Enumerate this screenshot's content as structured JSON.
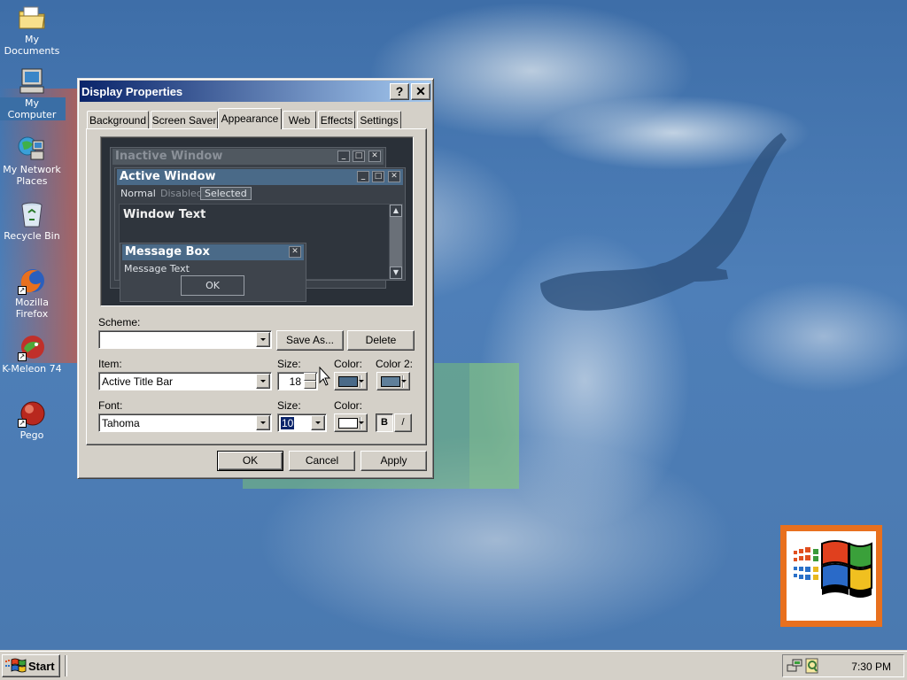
{
  "desktop": {
    "icons": [
      {
        "label": "My Documents",
        "icon": "folder-documents-icon"
      },
      {
        "label": "My Computer",
        "icon": "computer-icon"
      },
      {
        "label": "My Network Places",
        "icon": "network-places-icon"
      },
      {
        "label": "Recycle Bin",
        "icon": "recycle-bin-icon"
      },
      {
        "label": "Mozilla Firefox",
        "icon": "firefox-icon"
      },
      {
        "label": "K-Meleon 74",
        "icon": "k-meleon-icon"
      },
      {
        "label": "Pego",
        "icon": "pego-icon"
      }
    ],
    "background_color": "#4a79b0"
  },
  "dialog": {
    "title": "Display Properties",
    "help_glyph": "?",
    "close_glyph": "✕",
    "tabs": [
      "Background",
      "Screen Saver",
      "Appearance",
      "Web",
      "Effects",
      "Settings"
    ],
    "active_tab": "Appearance",
    "preview": {
      "inactive_title": "Inactive Window",
      "active_title": "Active Window",
      "menu": {
        "normal": "Normal",
        "disabled": "Disabled",
        "selected": "Selected"
      },
      "window_text": "Window Text",
      "message_box_title": "Message Box",
      "message_text": "Message Text",
      "ok": "OK"
    },
    "scheme": {
      "label": "Scheme:",
      "value": "",
      "save_as": "Save As...",
      "delete": "Delete"
    },
    "item": {
      "label": "Item:",
      "value": "Active Title Bar",
      "size_label": "Size:",
      "size_value": "18",
      "color_label": "Color:",
      "color2_label": "Color 2:",
      "color_value": "#4a6a88",
      "color2_value": "#5f7f9a"
    },
    "font": {
      "label": "Font:",
      "value": "Tahoma",
      "size_label": "Size:",
      "size_value": "10",
      "color_label": "Color:",
      "color_value": "#ffffff",
      "bold": "B",
      "italic": "/"
    },
    "buttons": {
      "ok": "OK",
      "cancel": "Cancel",
      "apply": "Apply"
    }
  },
  "taskbar": {
    "start_label": "Start",
    "clock": "7:30 PM",
    "tray_icons": [
      "network-tray-icon",
      "search-tray-icon"
    ]
  },
  "colors": {
    "title_active_start": "#0a246a",
    "title_active_end": "#a6caf0",
    "button_face": "#d4d0c8",
    "preview_bg": "#2a3038",
    "preview_active_title": "#4a6a88",
    "preview_inactive_title": "#505860",
    "windows_logo_border": "#e8701e"
  }
}
